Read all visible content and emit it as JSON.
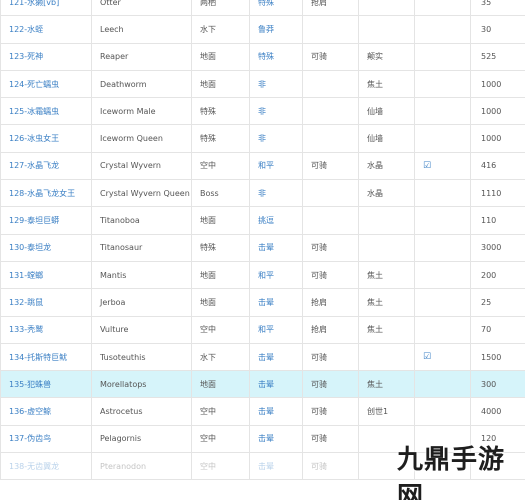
{
  "table": {
    "rows": [
      {
        "name": "121-水獭[vb]",
        "en": "Otter",
        "hab": "两栖",
        "temp": "特殊",
        "ride": "抢肩",
        "feed": "",
        "chk": "",
        "num": "35"
      },
      {
        "name": "122-水蛭",
        "en": "Leech",
        "hab": "水下",
        "temp": "鲁莽",
        "ride": "",
        "feed": "",
        "chk": "",
        "num": "30"
      },
      {
        "name": "123-死神",
        "en": "Reaper",
        "hab": "地面",
        "temp": "特殊",
        "ride": "可骑",
        "feed": "颠实",
        "chk": "",
        "num": "525"
      },
      {
        "name": "124-死亡蠕虫",
        "en": "Deathworm",
        "hab": "地面",
        "temp": "非",
        "ride": "",
        "feed": "焦土",
        "chk": "",
        "num": "1000"
      },
      {
        "name": "125-冰霜蠕虫",
        "en": "Iceworm Male",
        "hab": "特殊",
        "temp": "非",
        "ride": "",
        "feed": "仙墙",
        "chk": "",
        "num": "1000"
      },
      {
        "name": "126-冰虫女王",
        "en": "Iceworm Queen",
        "hab": "特殊",
        "temp": "非",
        "ride": "",
        "feed": "仙墙",
        "chk": "",
        "num": "1000"
      },
      {
        "name": "127-水晶飞龙",
        "en": "Crystal Wyvern",
        "hab": "空中",
        "temp": "和平",
        "ride": "可骑",
        "feed": "水晶",
        "chk": "☑",
        "num": "416"
      },
      {
        "name": "128-水晶飞龙女王",
        "en": "Crystal Wyvern Queen",
        "hab": "Boss",
        "temp": "非",
        "ride": "",
        "feed": "水晶",
        "chk": "",
        "num": "1110"
      },
      {
        "name": "129-泰坦巨蟒",
        "en": "Titanoboa",
        "hab": "地面",
        "temp": "挑逗",
        "ride": "",
        "feed": "",
        "chk": "",
        "num": "110"
      },
      {
        "name": "130-泰坦龙",
        "en": "Titanosaur",
        "hab": "特殊",
        "temp": "击晕",
        "ride": "可骑",
        "feed": "",
        "chk": "",
        "num": "3000"
      },
      {
        "name": "131-螳螂",
        "en": "Mantis",
        "hab": "地面",
        "temp": "和平",
        "ride": "可骑",
        "feed": "焦土",
        "chk": "",
        "num": "200"
      },
      {
        "name": "132-跳鼠",
        "en": "Jerboa",
        "hab": "地面",
        "temp": "击晕",
        "ride": "抢肩",
        "feed": "焦土",
        "chk": "",
        "num": "25"
      },
      {
        "name": "133-秃鹫",
        "en": "Vulture",
        "hab": "空中",
        "temp": "和平",
        "ride": "抢肩",
        "feed": "焦土",
        "chk": "",
        "num": "70"
      },
      {
        "name": "134-托斯特巨鱿",
        "en": "Tusoteuthis",
        "hab": "水下",
        "temp": "击晕",
        "ride": "可骑",
        "feed": "",
        "chk": "☑",
        "num": "1500"
      },
      {
        "name": "135-犯蛛兽",
        "en": "Morellatops",
        "hab": "地面",
        "temp": "击晕",
        "ride": "可骑",
        "feed": "焦土",
        "chk": "",
        "num": "300"
      },
      {
        "name": "136-虚空鲸",
        "en": "Astrocetus",
        "hab": "空中",
        "temp": "击晕",
        "ride": "可骑",
        "feed": "创世1",
        "chk": "",
        "num": "4000"
      },
      {
        "name": "137-伪齿鸟",
        "en": "Pelagornis",
        "hab": "空中",
        "temp": "击晕",
        "ride": "可骑",
        "feed": "",
        "chk": "",
        "num": "120"
      },
      {
        "name": "138-无齿翼龙",
        "en": "Pteranodon",
        "hab": "空中",
        "temp": "击晕",
        "ride": "可骑",
        "feed": "",
        "chk": "",
        "num": ""
      }
    ]
  },
  "highlight_color": "#d6f4fa",
  "link_color": "#3a7fc4",
  "watermark": {
    "text": "九鼎手游网"
  }
}
